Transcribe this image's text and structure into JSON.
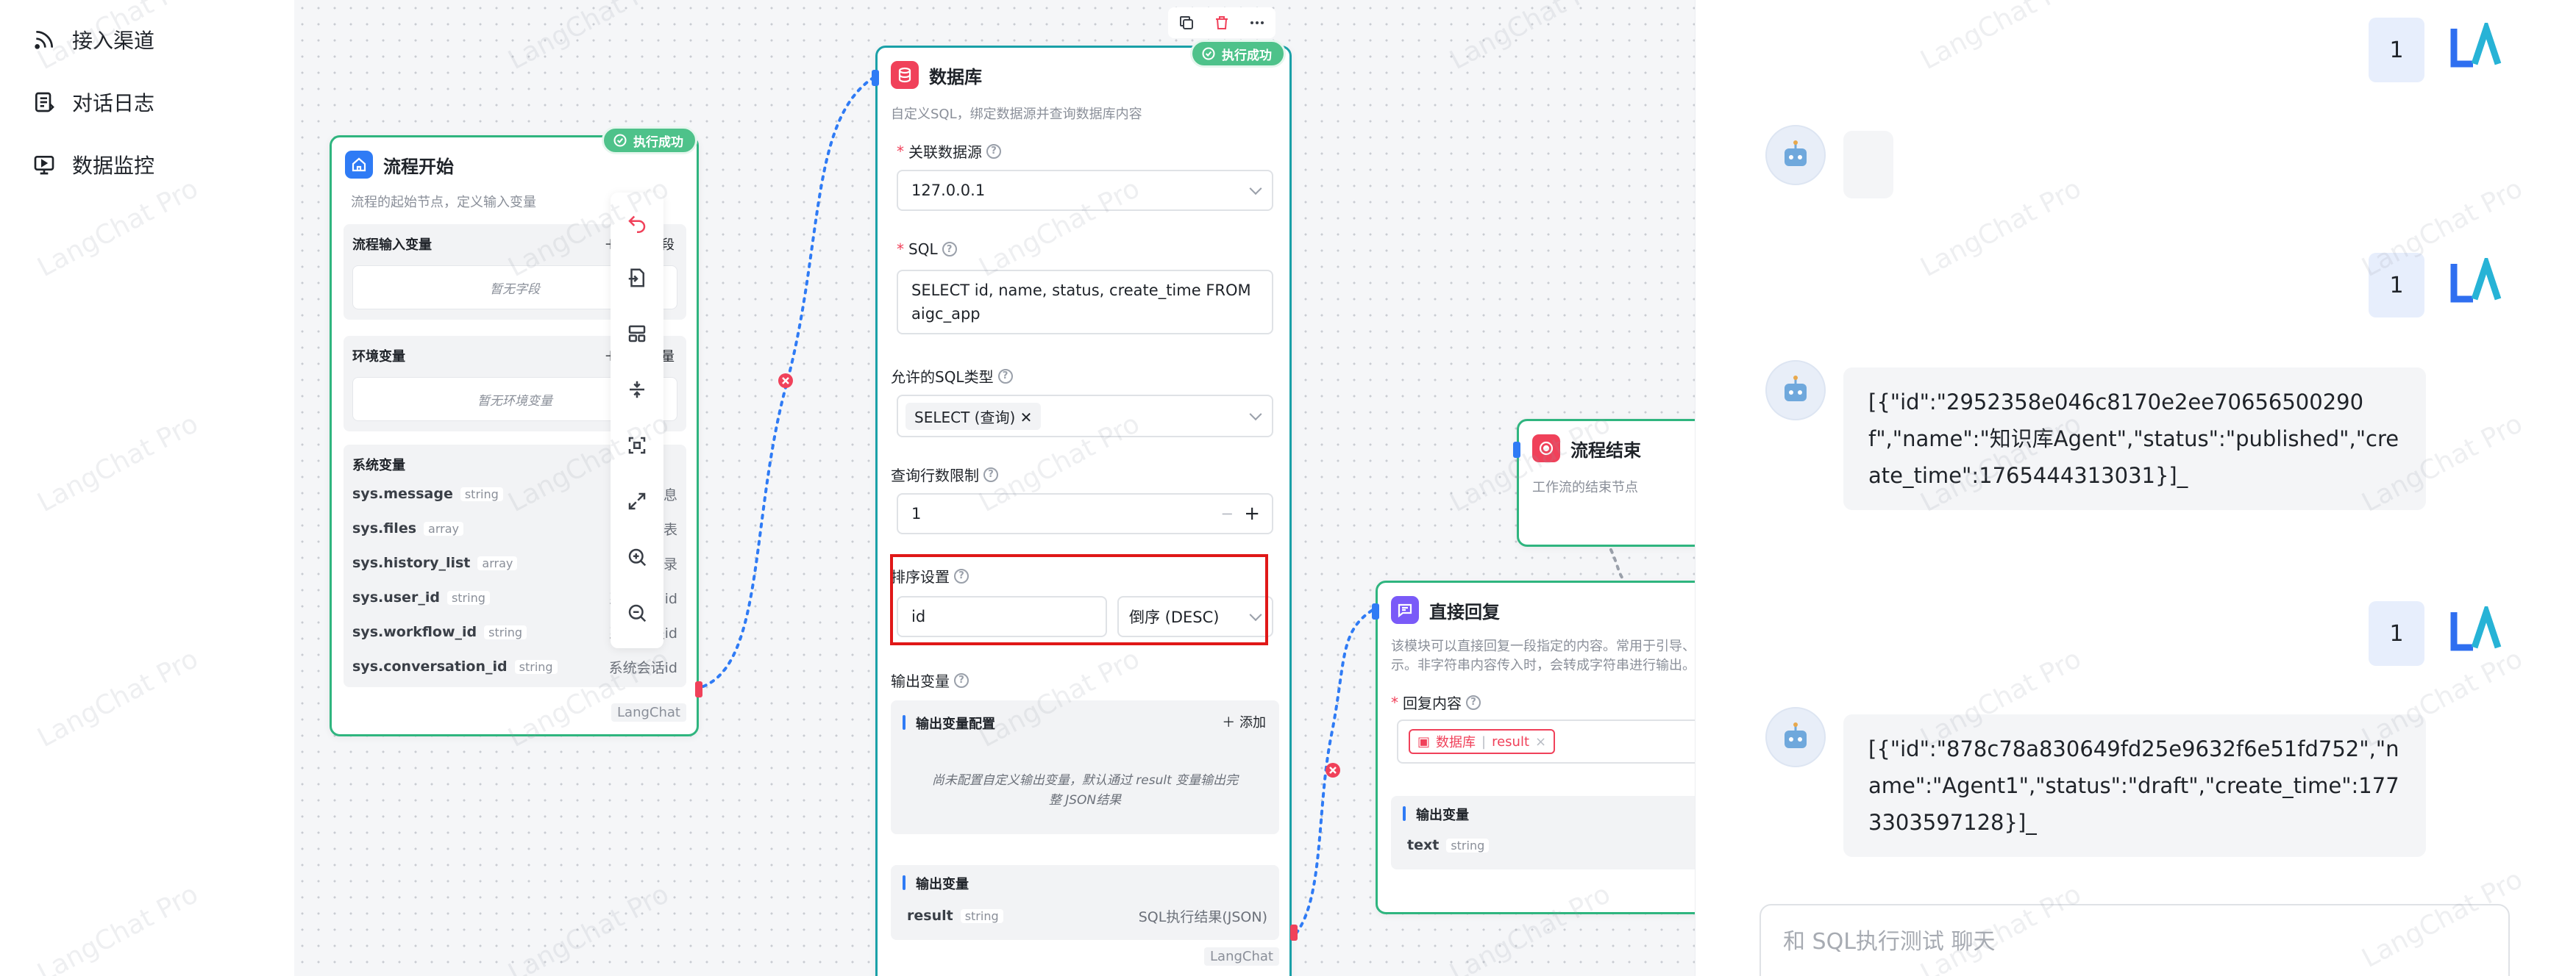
{
  "sidebar": {
    "items": [
      {
        "label": "接入渠道",
        "icon": "rss-icon"
      },
      {
        "label": "对话日志",
        "icon": "log-icon"
      },
      {
        "label": "数据监控",
        "icon": "monitor-icon"
      }
    ]
  },
  "toolbar": {
    "tools": [
      "undo-icon",
      "import-icon",
      "layout-icon",
      "collapse-icon",
      "fit-view-icon",
      "fullscreen-icon",
      "zoom-in-icon",
      "zoom-out-icon"
    ]
  },
  "start_node": {
    "title": "流程开始",
    "description": "流程的起始节点，定义输入变量",
    "status": "执行成功",
    "input_vars_title": "流程输入变量",
    "add_field": "添加字段",
    "input_empty": "暂无字段",
    "env_vars_title": "环境变量",
    "add_var": "添加变量",
    "env_empty": "暂无环境变量",
    "sys_vars_title": "系统变量",
    "sys_vars": [
      {
        "name": "sys.message",
        "type": "string",
        "desc": "用户消息"
      },
      {
        "name": "sys.files",
        "type": "array",
        "desc": "文件列表"
      },
      {
        "name": "sys.history_list",
        "type": "array",
        "desc": "消息记录"
      },
      {
        "name": "sys.user_id",
        "type": "string",
        "desc": "系统用户id"
      },
      {
        "name": "sys.workflow_id",
        "type": "string",
        "desc": "系统流程id"
      },
      {
        "name": "sys.conversation_id",
        "type": "string",
        "desc": "系统会话id"
      }
    ],
    "brand": "LangChat"
  },
  "db_node": {
    "title": "数据库",
    "description": "自定义SQL，绑定数据源并查询数据库内容",
    "status": "执行成功",
    "datasource_label": "关联数据源",
    "datasource_value": "127.0.0.1",
    "sql_label": "SQL",
    "sql_value": "SELECT id, name, status, create_time FROM aigc_app",
    "sql_types_label": "允许的SQL类型",
    "sql_type_tag": "SELECT (查询)",
    "limit_label": "查询行数限制",
    "limit_value": "1",
    "sort_label": "排序设置",
    "sort_field": "id",
    "sort_order": "倒序 (DESC)",
    "output_label": "输出变量",
    "output_config_title": "输出变量配置",
    "output_add": "添加",
    "output_empty": "尚未配置自定义输出变量，默认通过 result 变量输出完整 JSON结果",
    "output_vars_title": "输出变量",
    "output_var": {
      "name": "result",
      "type": "string",
      "desc": "SQL执行结果(JSON)"
    },
    "brand": "LangChat"
  },
  "end_node": {
    "title": "流程结束",
    "description": "工作流的结束节点"
  },
  "reply_node": {
    "title": "直接回复",
    "description": "该模块可以直接回复一段指定的内容。常用于引导、提示。非字符串内容传入时，会转成字符串进行输出。",
    "content_label": "回复内容",
    "ref_source": "数据库",
    "ref_var": "result",
    "output_vars_title": "输出变量",
    "output_var": {
      "name": "text",
      "type": "string"
    }
  },
  "chat": {
    "messages": [
      {
        "role": "user",
        "text": "1"
      },
      {
        "role": "bot",
        "text": ""
      },
      {
        "role": "user",
        "text": "1"
      },
      {
        "role": "bot",
        "text": "[{\"id\":\"2952358e046c8170e2ee70656500290f\",\"name\":\"知识库Agent\",\"status\":\"published\",\"create_time\":1765444313031}]_"
      },
      {
        "role": "user",
        "text": "1"
      },
      {
        "role": "bot",
        "text": "[{\"id\":\"878c78a830649fd25e9632f6e51fd752\",\"name\":\"Agent1\",\"status\":\"draft\",\"create_time\":1773303597128}]_"
      }
    ],
    "user_avatar": "LA",
    "input_placeholder": "和 SQL执行测试 聊天"
  },
  "watermark": "LangChat Pro",
  "colors": {
    "node_border": "#2fb57f",
    "db_border": "#1aa0a8",
    "success": "#4ec28a",
    "wire": "#2f7bf5",
    "highlight": "#e01818",
    "user_bubble": "#e7eefc"
  }
}
